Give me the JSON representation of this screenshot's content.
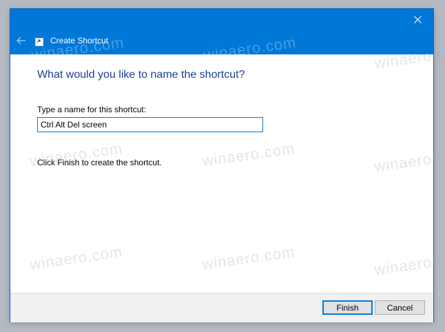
{
  "window": {
    "title": "Create Shortcut",
    "accent_color": "#0078d7",
    "heading_color": "#1c3f94"
  },
  "icons": {
    "back": "left-arrow-icon",
    "app": "shortcut-icon",
    "close": "close-icon"
  },
  "main": {
    "heading": "What would you like to name the shortcut?",
    "name_label": "Type a name for this shortcut:",
    "name_value": "Ctrl Alt Del screen",
    "hint": "Click Finish to create the shortcut."
  },
  "footer": {
    "finish_label": "Finish",
    "cancel_label": "Cancel"
  },
  "watermark": {
    "text": "winaero.com"
  }
}
